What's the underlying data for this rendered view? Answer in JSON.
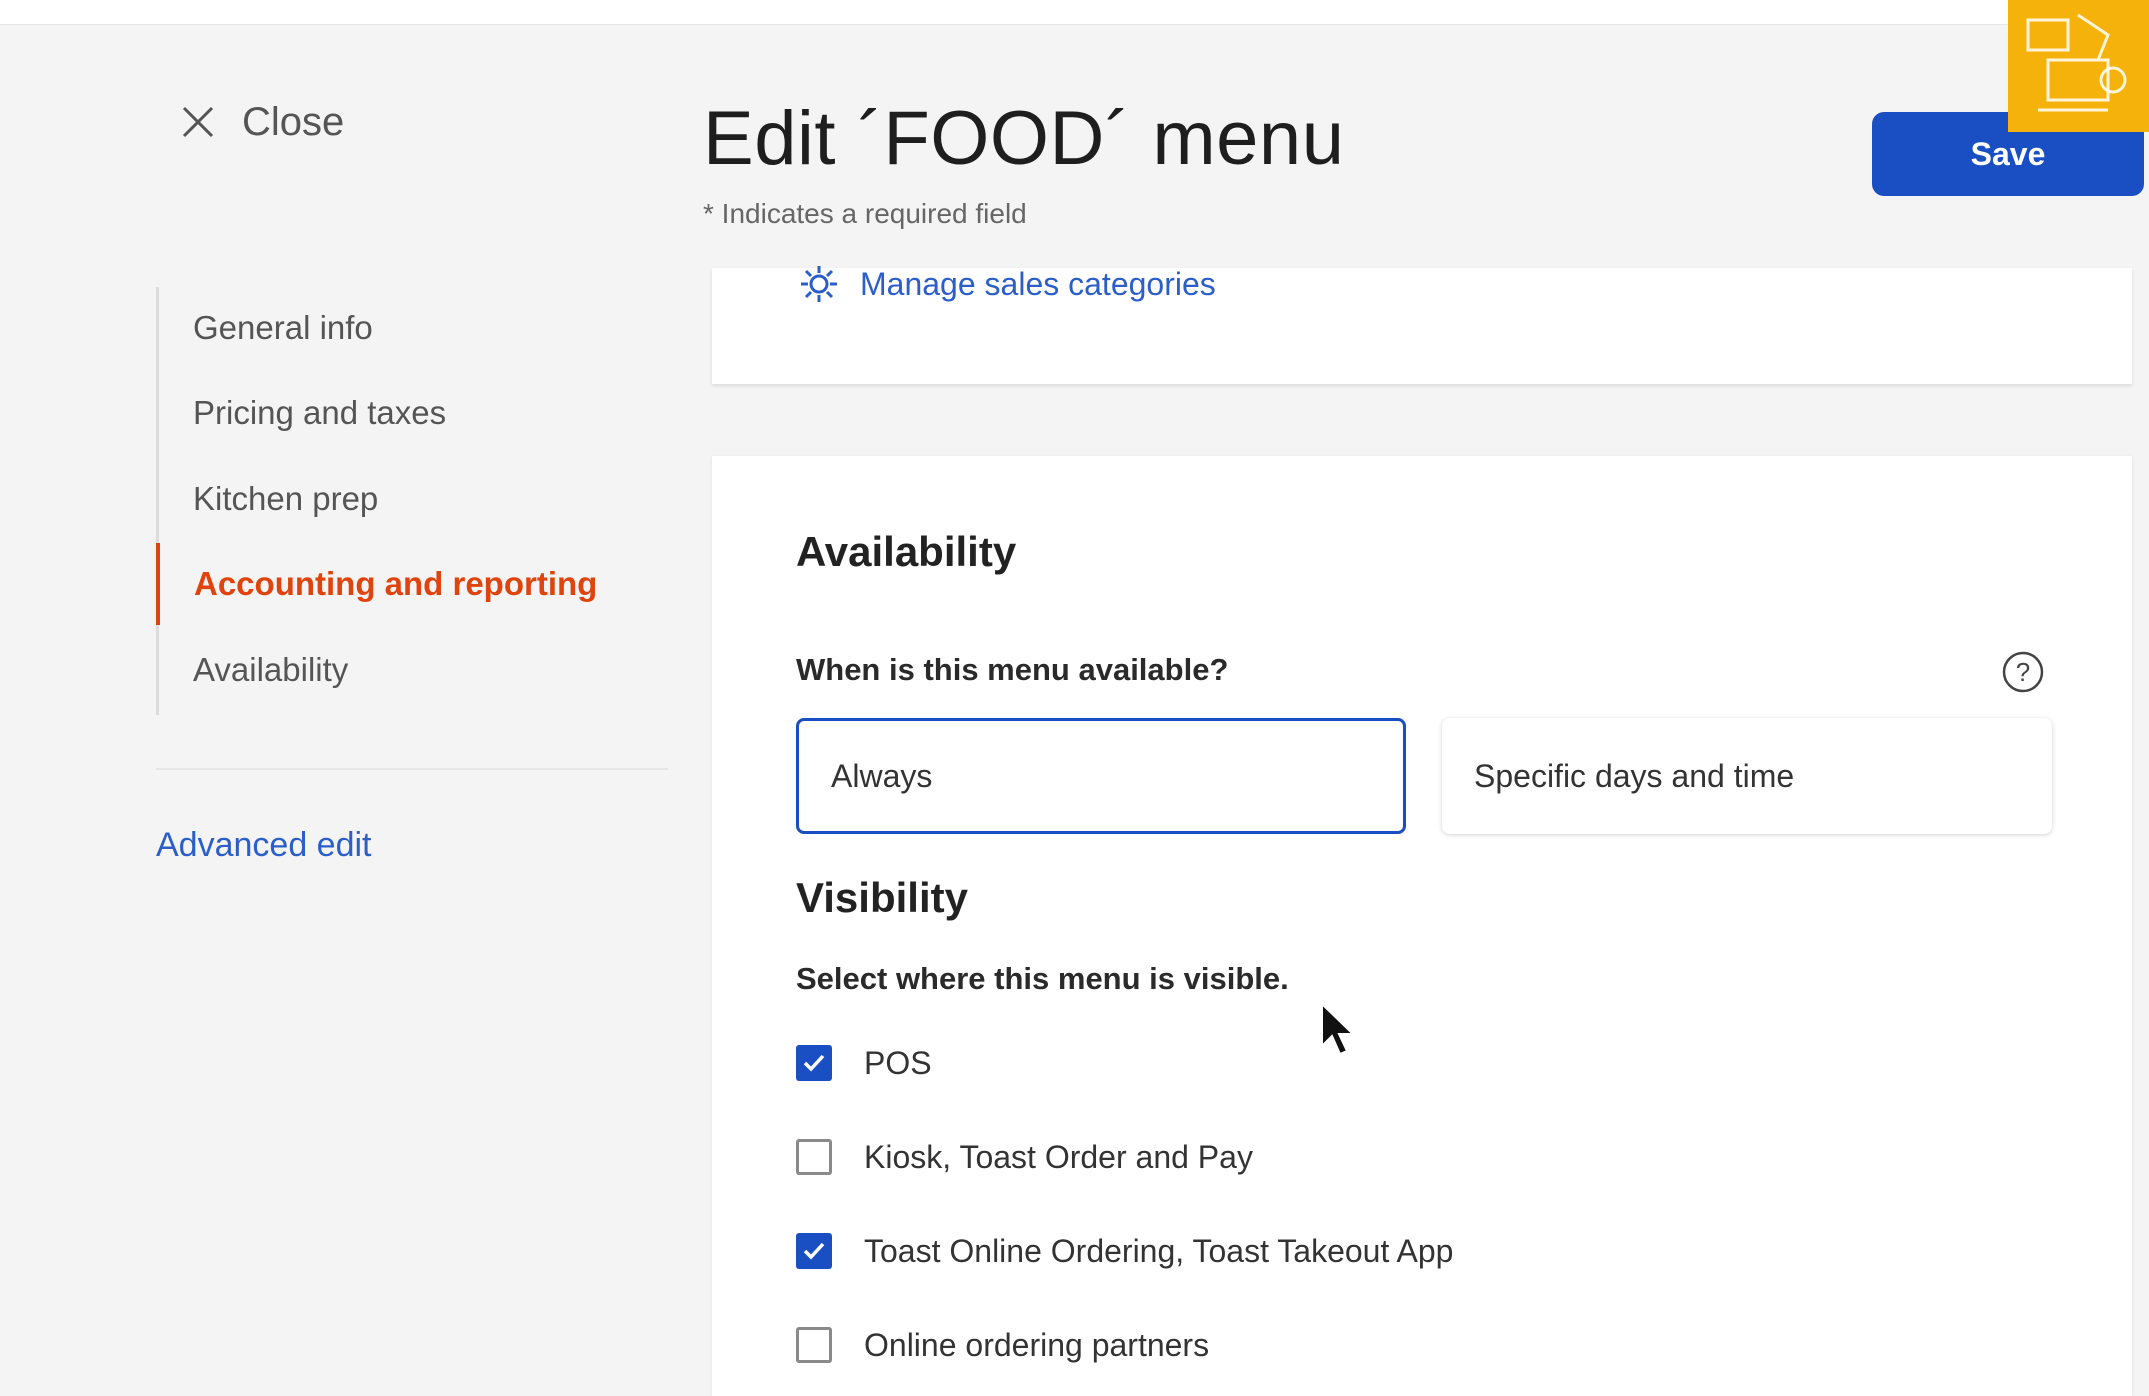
{
  "header": {
    "close_label": "Close",
    "title": "Edit ´FOOD´ menu",
    "required_note": "* Indicates a required field",
    "save_label": "Save"
  },
  "sidebar": {
    "items": [
      {
        "label": "General info",
        "active": false
      },
      {
        "label": "Pricing and taxes",
        "active": false
      },
      {
        "label": "Kitchen prep",
        "active": false
      },
      {
        "label": "Accounting and reporting",
        "active": true
      },
      {
        "label": "Availability",
        "active": false
      }
    ],
    "advanced_edit": "Advanced edit"
  },
  "sales_card": {
    "manage_link": "Manage sales categories"
  },
  "availability": {
    "title": "Availability",
    "question": "When is this menu available?",
    "options": [
      {
        "label": "Always",
        "selected": true
      },
      {
        "label": "Specific days and time",
        "selected": false
      }
    ]
  },
  "visibility": {
    "title": "Visibility",
    "prompt": "Select where this menu is visible.",
    "channels": [
      {
        "label": "POS",
        "checked": true
      },
      {
        "label": "Kiosk, Toast Order and Pay",
        "checked": false
      },
      {
        "label": "Toast Online Ordering, Toast Takeout App",
        "checked": true
      },
      {
        "label": "Online ordering partners",
        "checked": false
      }
    ]
  },
  "colors": {
    "primary": "#1a4fc4",
    "active_nav": "#e0440e",
    "link": "#2b5ec9",
    "badge": "#f5b20a"
  }
}
